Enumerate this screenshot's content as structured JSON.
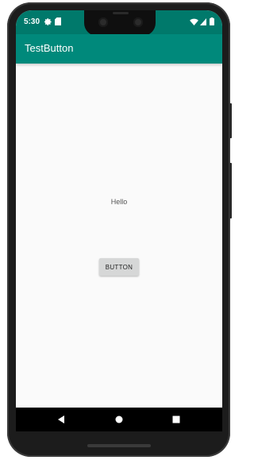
{
  "status_bar": {
    "time": "5:30",
    "icons": [
      "gear-icon",
      "sd-card-icon",
      "wifi-icon",
      "signal-icon",
      "battery-icon"
    ],
    "background_color": "#00796b"
  },
  "app_bar": {
    "title": "TestButton",
    "background_color": "#00897b"
  },
  "content": {
    "hello_text": "Hello",
    "button_label": "BUTTON"
  },
  "nav_bar": {
    "icons": [
      "back-icon",
      "home-icon",
      "recents-icon"
    ]
  }
}
